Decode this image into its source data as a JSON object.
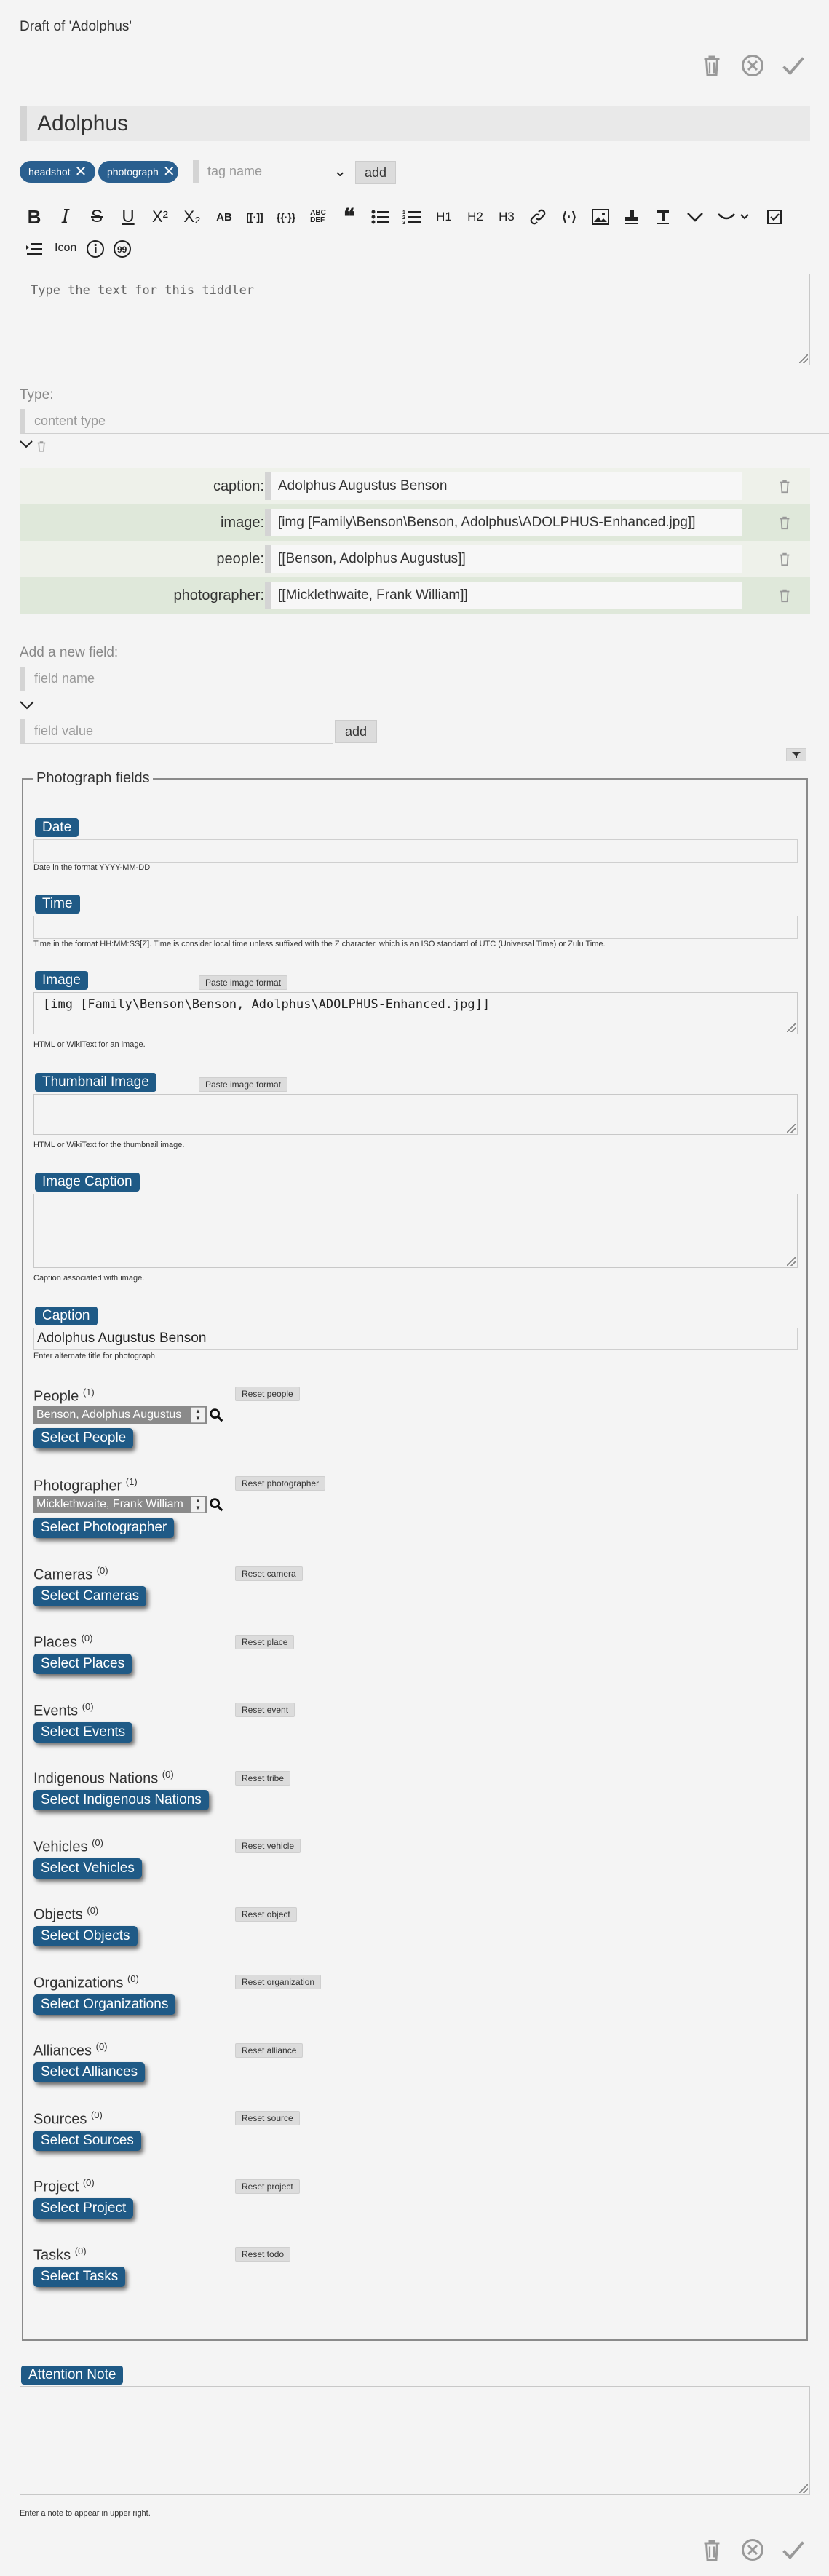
{
  "header": {
    "draft_title": "Draft of 'Adolphus'",
    "title_value": "Adolphus"
  },
  "toolbar_top": {
    "delete_icon": "trash-icon",
    "cancel_icon": "circle-x-icon",
    "done_icon": "check-icon"
  },
  "tags": {
    "items": [
      "headshot",
      "photograph"
    ],
    "tag_name_placeholder": "tag name",
    "add_label": "add"
  },
  "editor_toolbar": {
    "row1": [
      "B",
      "I",
      "S",
      "U",
      "X²",
      "X₂",
      "AB",
      "[[·]]",
      "{{·}}",
      "abc",
      "❝",
      "list",
      "numlist",
      "H1",
      "H2",
      "H3",
      "link",
      "mark",
      "image",
      "stamp",
      "T",
      "more",
      "smile",
      "check"
    ],
    "row2_icon_label": "Icon"
  },
  "body_placeholder": "Type the text for this tiddler",
  "type": {
    "label": "Type:",
    "placeholder": "content type"
  },
  "fields": [
    {
      "name": "caption:",
      "value": "Adolphus Augustus Benson"
    },
    {
      "name": "image:",
      "value": "[img [Family\\Benson\\Benson, Adolphus\\ADOLPHUS-Enhanced.jpg]]"
    },
    {
      "name": "people:",
      "value": "[[Benson, Adolphus Augustus]]"
    },
    {
      "name": "photographer:",
      "value": "[[Micklethwaite, Frank William]]"
    }
  ],
  "new_field": {
    "label": "Add a new field:",
    "name_placeholder": "field name",
    "value_placeholder": "field value",
    "add_label": "add"
  },
  "photo_fields": {
    "legend": "Photograph fields",
    "date_label": "Date",
    "date_hint": "Date in the format YYYY-MM-DD",
    "time_label": "Time",
    "time_hint": "Time in the format HH:MM:SS[Z]. Time is consider local time unless suffixed with the Z character, which is an ISO standard of UTC (Universal Time) or Zulu Time.",
    "image_label": "Image",
    "paste_label": "Paste image format",
    "image_value": "[img [Family\\Benson\\Benson, Adolphus\\ADOLPHUS-Enhanced.jpg]]",
    "image_hint": "HTML or WikiText for an image.",
    "thumb_label": "Thumbnail Image",
    "thumb_hint": "HTML or WikiText for the thumbnail image.",
    "img_caption_label": "Image Caption",
    "img_caption_hint": "Caption associated with image.",
    "caption_label": "Caption",
    "caption_value": "Adolphus Augustus Benson",
    "caption_hint": "Enter alternate title for photograph."
  },
  "relations": [
    {
      "label": "People",
      "count": "(1)",
      "reset": "Reset people",
      "select": "Select People",
      "selected": "Benson, Adolphus Augustus"
    },
    {
      "label": "Photographer",
      "count": "(1)",
      "reset": "Reset photographer",
      "select": "Select Photographer",
      "selected": "Micklethwaite, Frank William"
    },
    {
      "label": "Cameras",
      "count": "(0)",
      "reset": "Reset camera",
      "select": "Select Cameras"
    },
    {
      "label": "Places",
      "count": "(0)",
      "reset": "Reset place",
      "select": "Select Places"
    },
    {
      "label": "Events",
      "count": "(0)",
      "reset": "Reset event",
      "select": "Select Events"
    },
    {
      "label": "Indigenous Nations",
      "count": "(0)",
      "reset": "Reset tribe",
      "select": "Select Indigenous Nations"
    },
    {
      "label": "Vehicles",
      "count": "(0)",
      "reset": "Reset vehicle",
      "select": "Select Vehicles"
    },
    {
      "label": "Objects",
      "count": "(0)",
      "reset": "Reset object",
      "select": "Select Objects"
    },
    {
      "label": "Organizations",
      "count": "(0)",
      "reset": "Reset organization",
      "select": "Select Organizations"
    },
    {
      "label": "Alliances",
      "count": "(0)",
      "reset": "Reset alliance",
      "select": "Select Alliances"
    },
    {
      "label": "Sources",
      "count": "(0)",
      "reset": "Reset source",
      "select": "Select Sources"
    },
    {
      "label": "Project",
      "count": "(0)",
      "reset": "Reset project",
      "select": "Select Project"
    },
    {
      "label": "Tasks",
      "count": "(0)",
      "reset": "Reset todo",
      "select": "Select Tasks"
    }
  ],
  "attention": {
    "label": "Attention Note",
    "hint": "Enter a note to appear in upper right."
  },
  "colors": {
    "accent": "#1f5a86",
    "tag_pill": "#2a5f8f",
    "field_row_alt": "#dfe8da"
  }
}
